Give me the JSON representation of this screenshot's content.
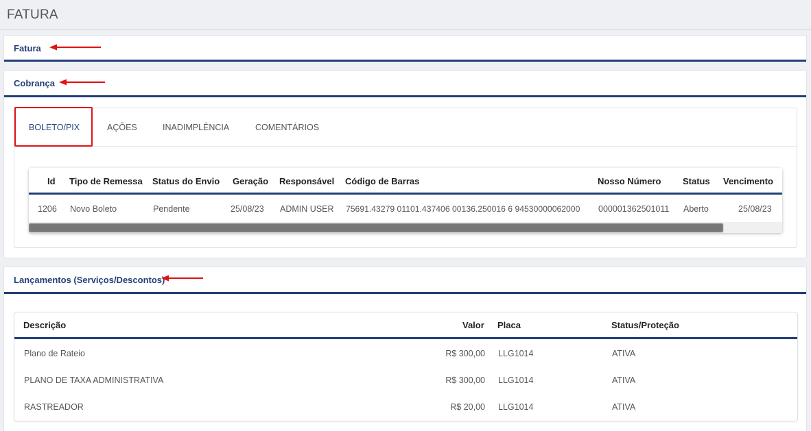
{
  "page": {
    "title": "FATURA"
  },
  "sections": {
    "fatura": {
      "title": "Fatura"
    },
    "cobranca": {
      "title": "Cobrança"
    },
    "lancamentos": {
      "title": "Lançamentos (Serviços/Descontos)"
    }
  },
  "annotations": {
    "arrow_color": "#e01414"
  },
  "cobranca": {
    "tabs": [
      {
        "label": "BOLETO/PIX",
        "active": true
      },
      {
        "label": "AÇÕES",
        "active": false
      },
      {
        "label": "INADIMPLÊNCIA",
        "active": false
      },
      {
        "label": "COMENTÁRIOS",
        "active": false
      }
    ],
    "boletos": {
      "columns": [
        "Id",
        "Tipo de Remessa",
        "Status do Envio",
        "Geração",
        "Responsável",
        "Código de Barras",
        "Nosso Número",
        "Status",
        "Vencimento"
      ],
      "rows": [
        {
          "id": "1206",
          "tipo": "Novo Boleto",
          "status_envio": "Pendente",
          "geracao": "25/08/23",
          "responsavel": "ADMIN USER",
          "codigo": "75691.43279 01101.437406 00136.250016 6 94530000062000",
          "nosso_numero": "000001362501011",
          "status": "Aberto",
          "vencimento": "25/08/23"
        }
      ]
    }
  },
  "lancamentos": {
    "columns": [
      "Descrição",
      "Valor",
      "Placa",
      "Status/Proteção"
    ],
    "rows": [
      {
        "descricao": "Plano de Rateio",
        "valor": "R$ 300,00",
        "placa": "LLG1014",
        "status": "ATIVA"
      },
      {
        "descricao": "PLANO DE TAXA ADMINISTRATIVA",
        "valor": "R$ 300,00",
        "placa": "LLG1014",
        "status": "ATIVA"
      },
      {
        "descricao": "RASTREADOR",
        "valor": "R$ 20,00",
        "placa": "LLG1014",
        "status": "ATIVA"
      }
    ]
  }
}
